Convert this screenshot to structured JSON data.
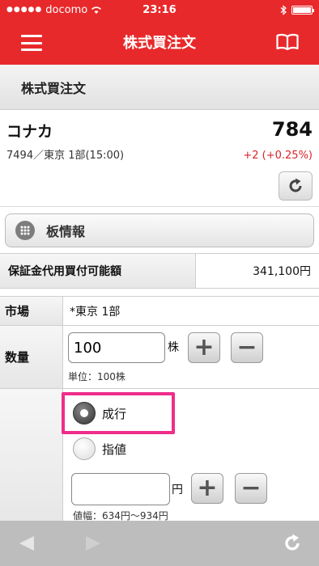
{
  "status_bar": {
    "carrier": "docomo",
    "signal_dots": "●●●●●",
    "time": "23:16"
  },
  "nav": {
    "title": "株式買注文"
  },
  "section": {
    "title": "株式買注文"
  },
  "stock": {
    "name": "コナカ",
    "code_market": "7494／東京 1部(15:00)",
    "price": "784",
    "change": "+2 (+0.25%)"
  },
  "board": {
    "label": "板情報"
  },
  "margin": {
    "label": "保証金代用買付可能額",
    "value": "341,100円"
  },
  "form": {
    "market": {
      "label": "市場",
      "value": "*東京 1部"
    },
    "quantity": {
      "label": "数量",
      "value": "100",
      "unit": "株",
      "unit_note": "単位：100株"
    },
    "order_type": {
      "market_label": "成行",
      "limit_label": "指値",
      "price_unit": "円",
      "range_note": "値幅：634円〜934円",
      "selected": "market"
    },
    "plus_glyph": "+",
    "minus_glyph": "−"
  },
  "colors": {
    "brand": "#e8292b",
    "price_change": "#d9232a",
    "highlight": "#ef2d8a"
  },
  "icons": [
    "menu-icon",
    "book-icon",
    "refresh-icon",
    "grid-icon",
    "back-arrow-icon",
    "forward-arrow-icon",
    "reload-icon",
    "wifi-icon",
    "bluetooth-icon",
    "battery-icon"
  ]
}
